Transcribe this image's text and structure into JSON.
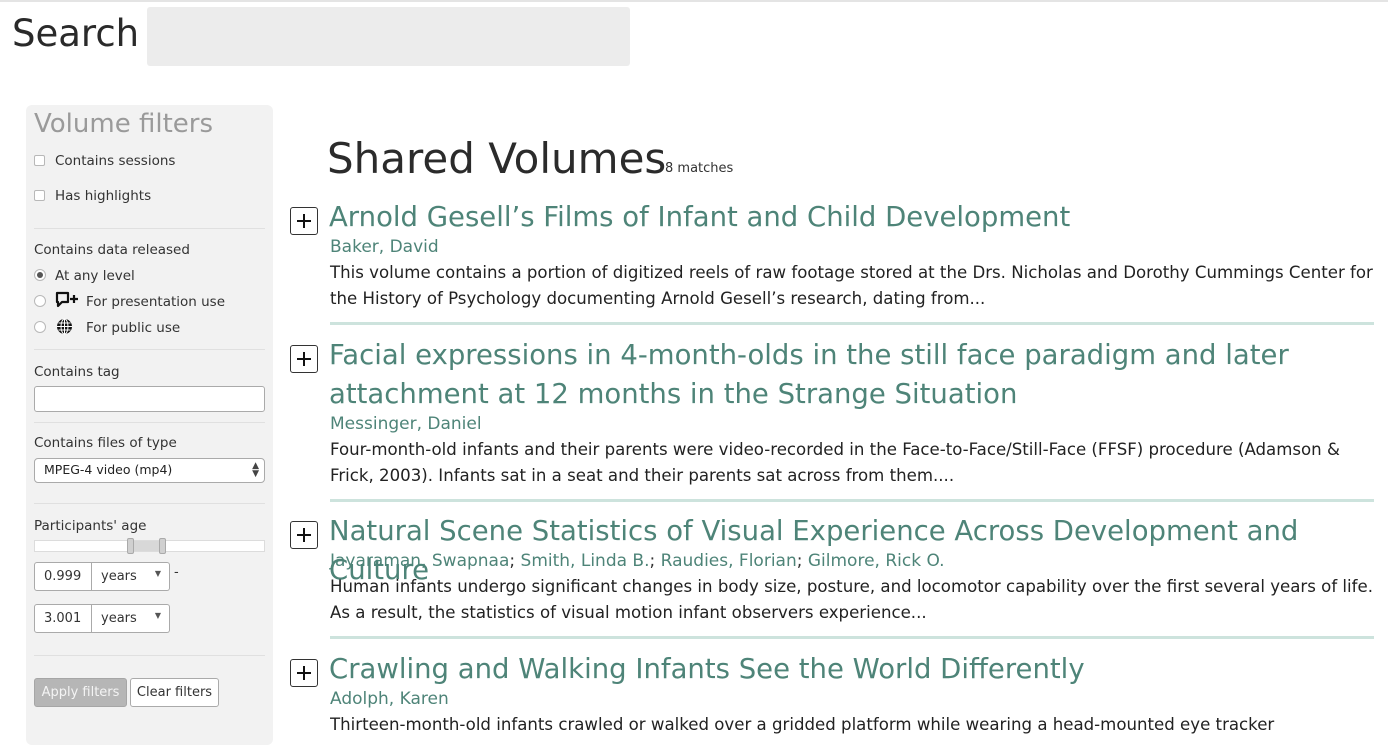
{
  "search": {
    "label": "Search",
    "value": ""
  },
  "filters": {
    "title": "Volume filters",
    "contains_sessions": "Contains sessions",
    "has_highlights": "Has highlights",
    "release_label": "Contains data released",
    "release_options": [
      "At any level",
      "For presentation use",
      "For public use"
    ],
    "tag_label": "Contains tag",
    "tag_value": "",
    "filetype_label": "Contains files of type",
    "filetype_value": "MPEG-4 video (mp4)",
    "age_label": "Participants' age",
    "age_min": "0.999",
    "age_min_unit": "years",
    "age_max": "3.001",
    "age_max_unit": "years",
    "apply_label": "Apply filters",
    "clear_label": "Clear filters"
  },
  "results": {
    "heading": "Shared Volumes",
    "count": "8 matches",
    "volumes": [
      {
        "title": "Arnold Gesell’s Films of Infant and Child Development",
        "authors": [
          "Baker, David"
        ],
        "description": "This volume contains a portion of digitized reels of raw footage stored at the Drs. Nicholas and Dorothy Cummings Center for the History of Psychology documenting Arnold Gesell’s research, dating from..."
      },
      {
        "title": "Facial expressions in 4-month-olds in the still face paradigm and later attachment at 12 months in the Strange Situation",
        "authors": [
          "Messinger, Daniel"
        ],
        "description": "Four-month-old infants and their parents were video-recorded in the Face-to-Face/Still-Face (FFSF) procedure (Adamson & Frick, 2003). Infants sat in a seat and their parents sat across from them...."
      },
      {
        "title": "Natural Scene Statistics of Visual Experience Across Development and Culture",
        "authors": [
          "Jayaraman, Swapnaa",
          "Smith, Linda B.",
          "Raudies, Florian",
          "Gilmore, Rick O."
        ],
        "description": "Human infants undergo significant changes in body size, posture, and locomotor capability over the first several years of life. As a result, the statistics of visual motion infant observers experience..."
      },
      {
        "title": "Crawling and Walking Infants See the World Differently",
        "authors": [
          "Adolph, Karen"
        ],
        "description": "Thirteen-month-old infants crawled or walked over a gridded platform while wearing a head-mounted eye tracker"
      }
    ]
  }
}
